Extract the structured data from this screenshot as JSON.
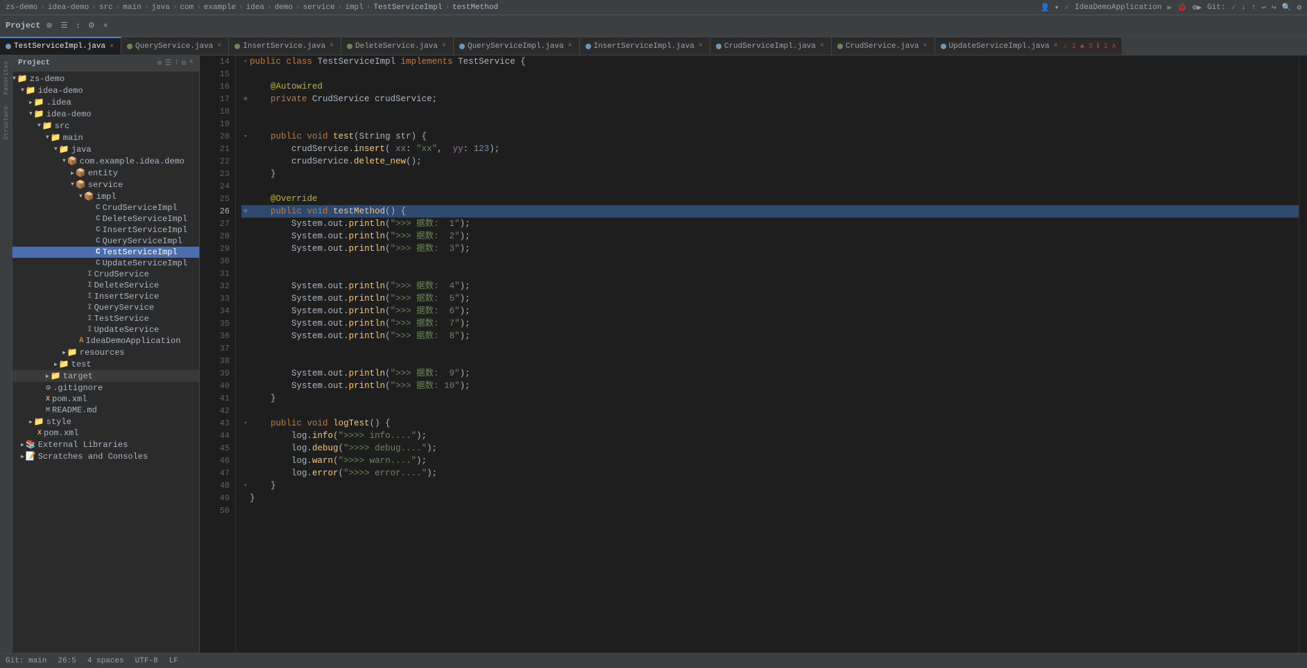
{
  "topbar": {
    "breadcrumb": [
      "zs-demo",
      "idea-demo",
      "src",
      "main",
      "java",
      "com",
      "example",
      "idea",
      "demo",
      "service",
      "impl"
    ],
    "active_file": "TestServiceImpl",
    "method": "testMethod",
    "run_config": "IdeaDemoApplication",
    "git": "Git:"
  },
  "toolbar": {
    "project_label": "Project",
    "icons": [
      "☰",
      "≡",
      "⚙",
      "×"
    ]
  },
  "tabs": [
    {
      "id": "TestServiceImpl.java",
      "label": "TestServiceImpl.java",
      "color": "#6897bb",
      "active": true
    },
    {
      "id": "QueryService.java",
      "label": "QueryService.java",
      "color": "#6a8759",
      "active": false
    },
    {
      "id": "InsertService.java",
      "label": "InsertService.java",
      "color": "#6a8759",
      "active": false
    },
    {
      "id": "DeleteService.java",
      "label": "DeleteService.java",
      "color": "#6a8759",
      "active": false
    },
    {
      "id": "QueryServiceImpl.java",
      "label": "QueryServiceImpl.java",
      "color": "#6897bb",
      "active": false
    },
    {
      "id": "InsertServiceImpl.java",
      "label": "InsertServiceImpl.java",
      "color": "#6897bb",
      "active": false
    },
    {
      "id": "CrudServiceImpl.java",
      "label": "CrudServiceImpl.java",
      "color": "#6897bb",
      "active": false
    },
    {
      "id": "CrudService.java",
      "label": "CrudService.java",
      "color": "#6a8759",
      "active": false
    },
    {
      "id": "UpdateServiceImpl.java",
      "label": "UpdateServiceImpl.java",
      "color": "#6897bb",
      "active": false
    }
  ],
  "tree": {
    "header": "Project",
    "items": [
      {
        "id": "zs-demo",
        "label": "zs-demo",
        "indent": 0,
        "type": "folder-open",
        "icon": "▼",
        "color": "#f5c518"
      },
      {
        "id": "idea-demo",
        "label": "idea-demo",
        "indent": 1,
        "type": "folder-open",
        "icon": "▼",
        "color": "#f5c518"
      },
      {
        "id": ".idea",
        "label": ".idea",
        "indent": 2,
        "type": "folder-closed",
        "icon": "▶",
        "color": "#f5c518"
      },
      {
        "id": "idea-demo-root",
        "label": "idea-demo",
        "indent": 2,
        "type": "folder-open",
        "icon": "▼",
        "color": "#f5c518"
      },
      {
        "id": "src",
        "label": "src",
        "indent": 3,
        "type": "folder-open",
        "icon": "▼",
        "color": "#6897bb"
      },
      {
        "id": "main",
        "label": "main",
        "indent": 4,
        "type": "folder-open",
        "icon": "▼",
        "color": "#6897bb"
      },
      {
        "id": "java",
        "label": "java",
        "indent": 5,
        "type": "folder-open",
        "icon": "▼",
        "color": "#6897bb"
      },
      {
        "id": "com.example.idea.demo",
        "label": "com.example.idea.demo",
        "indent": 6,
        "type": "folder-open",
        "icon": "▼",
        "color": "#a9b7c6"
      },
      {
        "id": "entity",
        "label": "entity",
        "indent": 7,
        "type": "folder-closed",
        "icon": "▶",
        "color": "#a9b7c6"
      },
      {
        "id": "service",
        "label": "service",
        "indent": 7,
        "type": "folder-open",
        "icon": "▼",
        "color": "#a9b7c6"
      },
      {
        "id": "impl",
        "label": "impl",
        "indent": 8,
        "type": "folder-open",
        "icon": "▼",
        "color": "#a9b7c6"
      },
      {
        "id": "CrudServiceImpl",
        "label": "CrudServiceImpl",
        "indent": 9,
        "type": "java-impl",
        "icon": "C",
        "color": "#6897bb"
      },
      {
        "id": "DeleteServiceImpl",
        "label": "DeleteServiceImpl",
        "indent": 9,
        "type": "java-impl",
        "icon": "C",
        "color": "#6897bb"
      },
      {
        "id": "InsertServiceImpl",
        "label": "InsertServiceImpl",
        "indent": 9,
        "type": "java-impl",
        "icon": "C",
        "color": "#6897bb"
      },
      {
        "id": "QueryServiceImpl",
        "label": "QueryServiceImpl",
        "indent": 9,
        "type": "java-impl",
        "icon": "C",
        "color": "#6897bb"
      },
      {
        "id": "TestServiceImpl",
        "label": "TestServiceImpl",
        "indent": 9,
        "type": "java-impl",
        "icon": "C",
        "color": "#6897bb",
        "selected": true
      },
      {
        "id": "UpdateServiceImpl",
        "label": "UpdateServiceImpl",
        "indent": 9,
        "type": "java-impl",
        "icon": "C",
        "color": "#6897bb"
      },
      {
        "id": "CrudService",
        "label": "CrudService",
        "indent": 8,
        "type": "java-int",
        "icon": "I",
        "color": "#6a8759"
      },
      {
        "id": "DeleteService",
        "label": "DeleteService",
        "indent": 8,
        "type": "java-int",
        "icon": "I",
        "color": "#6a8759"
      },
      {
        "id": "InsertService",
        "label": "InsertService",
        "indent": 8,
        "type": "java-int",
        "icon": "I",
        "color": "#6a8759"
      },
      {
        "id": "QueryService",
        "label": "QueryService",
        "indent": 8,
        "type": "java-int",
        "icon": "I",
        "color": "#6a8759"
      },
      {
        "id": "TestService",
        "label": "TestService",
        "indent": 8,
        "type": "java-int",
        "icon": "I",
        "color": "#6a8759"
      },
      {
        "id": "UpdateService",
        "label": "UpdateService",
        "indent": 8,
        "type": "java-int",
        "icon": "I",
        "color": "#6a8759"
      },
      {
        "id": "IdeaDemoApplication",
        "label": "IdeaDemoApplication",
        "indent": 7,
        "type": "java",
        "icon": "A",
        "color": "#c07f33"
      },
      {
        "id": "resources",
        "label": "resources",
        "indent": 6,
        "type": "folder-closed",
        "icon": "▶",
        "color": "#a9b7c6"
      },
      {
        "id": "test",
        "label": "test",
        "indent": 5,
        "type": "folder-closed",
        "icon": "▶",
        "color": "#a9b7c6"
      },
      {
        "id": "target",
        "label": "target",
        "indent": 4,
        "type": "folder-closed",
        "icon": "▶",
        "color": "#f5c518"
      },
      {
        "id": ".gitignore",
        "label": ".gitignore",
        "indent": 3,
        "type": "file",
        "icon": "⊙",
        "color": "#a9b7c6"
      },
      {
        "id": "pom.xml-inner",
        "label": "pom.xml",
        "indent": 3,
        "type": "xml",
        "icon": "X",
        "color": "#e8a06b"
      },
      {
        "id": "README.md",
        "label": "README.md",
        "indent": 3,
        "type": "md",
        "icon": "M",
        "color": "#a9b7c6"
      },
      {
        "id": "style",
        "label": "style",
        "indent": 2,
        "type": "folder-closed",
        "icon": "▶",
        "color": "#f5c518"
      },
      {
        "id": "pom.xml",
        "label": "pom.xml",
        "indent": 2,
        "type": "xml",
        "icon": "X",
        "color": "#e8a06b"
      },
      {
        "id": "External Libraries",
        "label": "External Libraries",
        "indent": 1,
        "type": "folder-closed",
        "icon": "▶",
        "color": "#a9b7c6"
      },
      {
        "id": "Scratches and Consoles",
        "label": "Scratches and Consoles",
        "indent": 1,
        "type": "folder-closed",
        "icon": "▶",
        "color": "#a9b7c6"
      }
    ]
  },
  "editor": {
    "filename": "TestServiceImpl.java",
    "lines": [
      {
        "num": 14,
        "fold": false,
        "content": "public class TestServiceImpl implements TestService {"
      },
      {
        "num": 15,
        "fold": false,
        "content": ""
      },
      {
        "num": 16,
        "fold": false,
        "content": "    @Autowired"
      },
      {
        "num": 17,
        "fold": false,
        "content": "    private CrudService crudService;"
      },
      {
        "num": 18,
        "fold": false,
        "content": ""
      },
      {
        "num": 19,
        "fold": false,
        "content": ""
      },
      {
        "num": 20,
        "fold": true,
        "content": "    public void test(String str) {"
      },
      {
        "num": 21,
        "fold": false,
        "content": "        crudService.insert( xx: \"xx\",  yy: 123);"
      },
      {
        "num": 22,
        "fold": false,
        "content": "        crudService.delete_new();"
      },
      {
        "num": 23,
        "fold": false,
        "content": "    }"
      },
      {
        "num": 24,
        "fold": false,
        "content": ""
      },
      {
        "num": 25,
        "fold": false,
        "content": "    @Override"
      },
      {
        "num": 26,
        "fold": true,
        "content": "    public void testMethod() {"
      },
      {
        "num": 27,
        "fold": false,
        "content": "        System.out.println(\">>> 据数:  1\");"
      },
      {
        "num": 28,
        "fold": false,
        "content": "        System.out.println(\">>> 据数:  2\");"
      },
      {
        "num": 29,
        "fold": false,
        "content": "        System.out.println(\">>> 据数:  3\");"
      },
      {
        "num": 30,
        "fold": false,
        "content": ""
      },
      {
        "num": 31,
        "fold": false,
        "content": ""
      },
      {
        "num": 32,
        "fold": false,
        "content": "        System.out.println(\">>> 据数:  4\");"
      },
      {
        "num": 33,
        "fold": false,
        "content": "        System.out.println(\">>> 据数:  5\");"
      },
      {
        "num": 34,
        "fold": false,
        "content": "        System.out.println(\">>> 据数:  6\");"
      },
      {
        "num": 35,
        "fold": false,
        "content": "        System.out.println(\">>> 据数:  7\");"
      },
      {
        "num": 36,
        "fold": false,
        "content": "        System.out.println(\">>> 据数:  8\");"
      },
      {
        "num": 37,
        "fold": false,
        "content": ""
      },
      {
        "num": 38,
        "fold": false,
        "content": ""
      },
      {
        "num": 39,
        "fold": false,
        "content": "        System.out.println(\">>> 据数:  9\");"
      },
      {
        "num": 40,
        "fold": false,
        "content": "        System.out.println(\">>> 据数: 10\");"
      },
      {
        "num": 41,
        "fold": false,
        "content": "    }"
      },
      {
        "num": 42,
        "fold": false,
        "content": ""
      },
      {
        "num": 43,
        "fold": true,
        "content": "    public void logTest() {"
      },
      {
        "num": 44,
        "fold": false,
        "content": "        log.info(\">>>> info....\");"
      },
      {
        "num": 45,
        "fold": false,
        "content": "        log.debug(\">>>> debug....\");"
      },
      {
        "num": 46,
        "fold": false,
        "content": "        log.warn(\">>>> warn....\");"
      },
      {
        "num": 47,
        "fold": false,
        "content": "        log.error(\">>>> error....\");"
      },
      {
        "num": 48,
        "fold": true,
        "content": "    }"
      },
      {
        "num": 49,
        "fold": false,
        "content": "}"
      },
      {
        "num": 50,
        "fold": false,
        "content": ""
      }
    ]
  },
  "statusbar": {
    "line_col": "26:5",
    "encoding": "UTF-8",
    "line_sep": "LF",
    "indent": "4 spaces",
    "git_branch": "Git: main"
  },
  "side_labels": [
    "Favorites",
    "Structure"
  ]
}
